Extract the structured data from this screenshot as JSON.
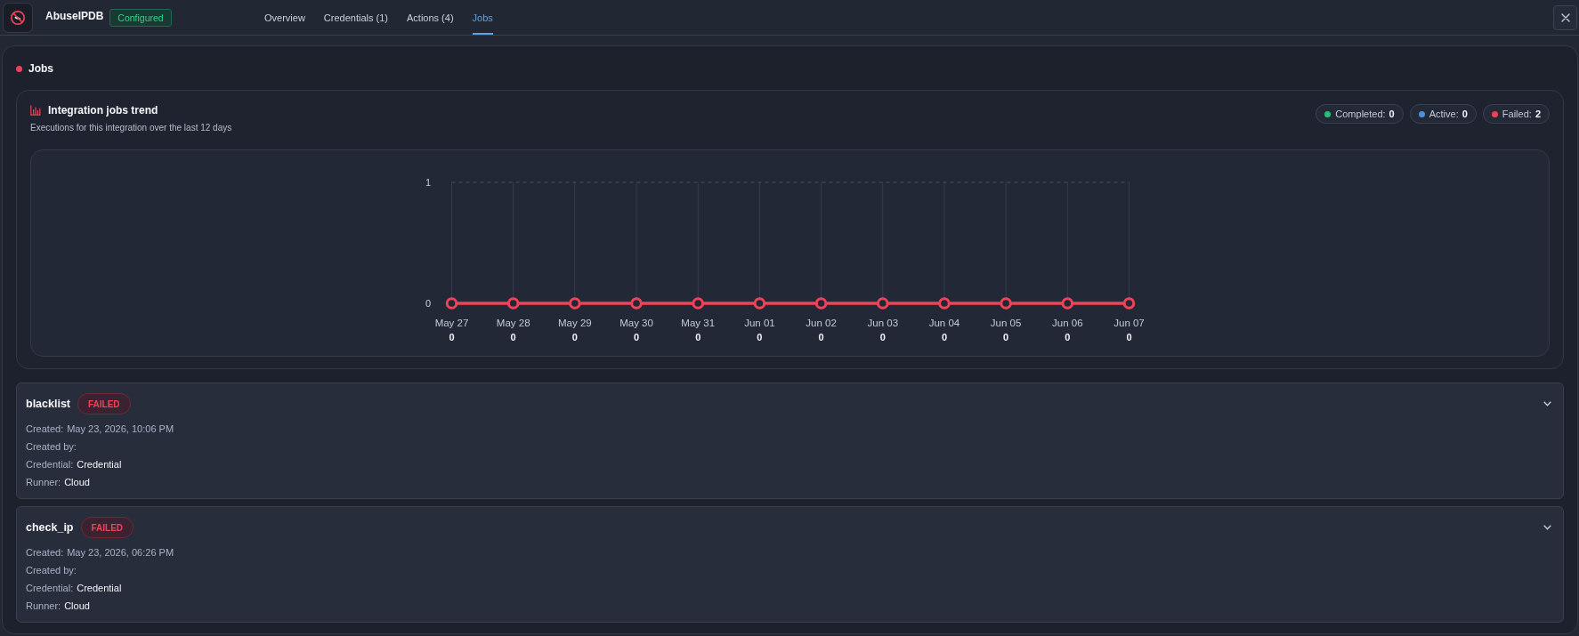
{
  "header": {
    "title": "AbuseIPDB",
    "badge": "Configured",
    "tabs": [
      {
        "label": "Overview",
        "selected": false
      },
      {
        "label": "Credentials (1)",
        "selected": false
      },
      {
        "label": "Actions (4)",
        "selected": false
      },
      {
        "label": "Jobs",
        "selected": true
      }
    ]
  },
  "section": {
    "title": "Jobs"
  },
  "trend": {
    "title": "Integration jobs trend",
    "subtitle": "Executions for this integration over the last 12 days",
    "status_counts": [
      {
        "label": "Completed:",
        "count": "0",
        "color": "#22c07a"
      },
      {
        "label": "Active:",
        "count": "0",
        "color": "#4a8fd8"
      },
      {
        "label": "Failed:",
        "count": "2",
        "color": "#ef4056"
      }
    ],
    "chart_data": {
      "type": "line",
      "categories": [
        "May 27",
        "May 28",
        "May 29",
        "May 30",
        "May 31",
        "Jun 01",
        "Jun 02",
        "Jun 03",
        "Jun 04",
        "Jun 05",
        "Jun 06",
        "Jun 07"
      ],
      "series": [
        {
          "color": "#f0435a",
          "marker": true,
          "values": [
            0,
            0,
            0,
            0,
            0,
            0,
            0,
            0,
            0,
            0,
            0,
            0
          ]
        }
      ],
      "ylim": [
        0,
        1
      ],
      "yticks": [
        0,
        1
      ],
      "grid": true,
      "data_labels": true
    }
  },
  "jobs": [
    {
      "name": "blacklist",
      "status": {
        "label": "FAILED",
        "kind": "failed"
      },
      "expanded": false,
      "details": [
        {
          "label": "Created:",
          "value": "May 23, 2026, 10:06 PM",
          "emphasis": false
        },
        {
          "label": "Created by:"
        },
        {
          "label": "Credential:",
          "value": "Credential",
          "emphasis": true
        },
        {
          "label": "Runner:",
          "value": "Cloud",
          "emphasis": true
        }
      ]
    },
    {
      "name": "check_ip",
      "status": {
        "label": "FAILED",
        "kind": "failed"
      },
      "expanded": false,
      "details": [
        {
          "label": "Created:",
          "value": "May 23, 2026, 06:26 PM",
          "emphasis": false
        },
        {
          "label": "Created by:"
        },
        {
          "label": "Credential:",
          "value": "Credential",
          "emphasis": true
        },
        {
          "label": "Runner:",
          "value": "Cloud",
          "emphasis": true
        }
      ]
    }
  ]
}
